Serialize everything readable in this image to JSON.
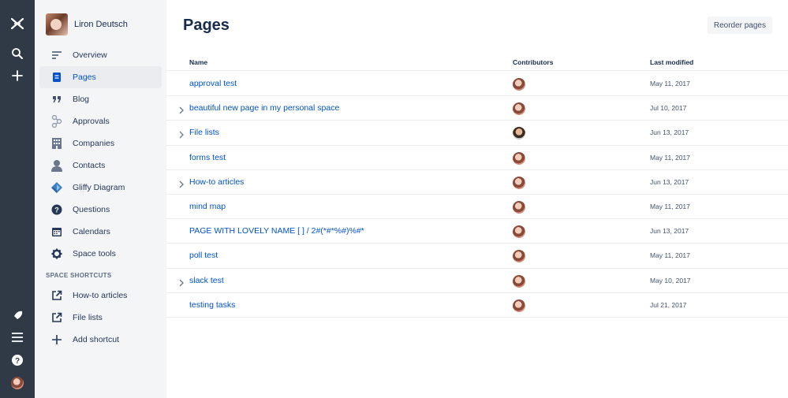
{
  "global_nav": {
    "icons": [
      "logo-icon",
      "search-icon",
      "create-icon",
      "notifications-icon",
      "menu-icon",
      "help-icon",
      "profile-icon"
    ]
  },
  "space": {
    "name": "Liron Deutsch"
  },
  "sidebar": {
    "items": [
      {
        "label": "Overview",
        "icon": "overview-icon",
        "active": false
      },
      {
        "label": "Pages",
        "icon": "pages-icon",
        "active": true
      },
      {
        "label": "Blog",
        "icon": "blog-quote-icon",
        "active": false
      },
      {
        "label": "Approvals",
        "icon": "approvals-icon",
        "active": false
      },
      {
        "label": "Companies",
        "icon": "companies-icon",
        "active": false
      },
      {
        "label": "Contacts",
        "icon": "contacts-icon",
        "active": false
      },
      {
        "label": "Gliffy Diagram",
        "icon": "gliffy-icon",
        "active": false
      },
      {
        "label": "Questions",
        "icon": "questions-icon",
        "active": false
      },
      {
        "label": "Calendars",
        "icon": "calendar-icon",
        "active": false
      },
      {
        "label": "Space tools",
        "icon": "gear-icon",
        "active": false
      }
    ],
    "shortcuts_title": "SPACE SHORTCUTS",
    "shortcuts": [
      {
        "label": "How-to articles",
        "icon": "external-link-icon"
      },
      {
        "label": "File lists",
        "icon": "external-link-icon"
      },
      {
        "label": "Add shortcut",
        "icon": "plus-icon"
      }
    ]
  },
  "main": {
    "title": "Pages",
    "reorder_button": "Reorder pages",
    "columns": {
      "name": "Name",
      "contributors": "Contributors",
      "last_modified": "Last modified"
    },
    "rows": [
      {
        "title": "approval test",
        "has_children": false,
        "date": "May 11, 2017",
        "avatar": "user-avatar"
      },
      {
        "title": "beautiful new page in my personal space",
        "has_children": true,
        "date": "Jul 10, 2017",
        "avatar": "user-avatar"
      },
      {
        "title": "File lists",
        "has_children": true,
        "date": "Jun 13, 2017",
        "avatar": "user-avatar-alt"
      },
      {
        "title": "forms test",
        "has_children": false,
        "date": "May 11, 2017",
        "avatar": "user-avatar"
      },
      {
        "title": "How-to articles",
        "has_children": true,
        "date": "Jun 13, 2017",
        "avatar": "user-avatar"
      },
      {
        "title": "mind map",
        "has_children": false,
        "date": "May 11, 2017",
        "avatar": "user-avatar"
      },
      {
        "title": "PAGE WITH LOVELY NAME [ ] / 2#(*#*%#)%#*",
        "has_children": false,
        "date": "Jun 13, 2017",
        "avatar": "user-avatar"
      },
      {
        "title": "poll test",
        "has_children": false,
        "date": "May 11, 2017",
        "avatar": "user-avatar"
      },
      {
        "title": "slack test",
        "has_children": true,
        "date": "May 10, 2017",
        "avatar": "user-avatar"
      },
      {
        "title": "testing tasks",
        "has_children": false,
        "date": "Jul 21, 2017",
        "avatar": "user-avatar"
      }
    ]
  },
  "colors": {
    "global_nav_bg": "#2f3a46",
    "sidebar_bg": "#f4f5f7",
    "link": "#0052cc",
    "text": "#172b4d"
  }
}
